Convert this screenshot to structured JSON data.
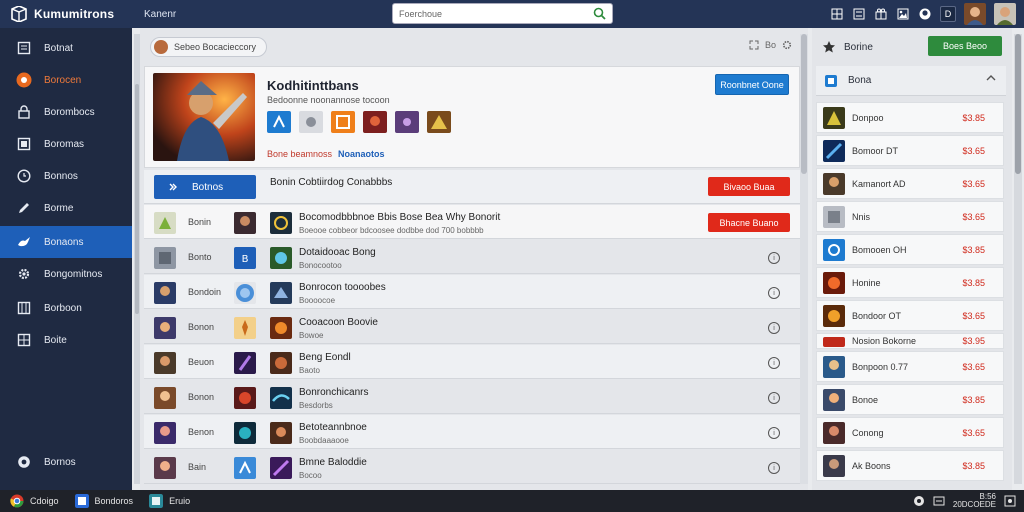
{
  "topbar": {
    "brand": "Kumumitrons",
    "link": "Kanenr",
    "search_placeholder": "Foerchoue",
    "icons": [
      "grid-icon",
      "list-icon",
      "gift-icon",
      "image-icon",
      "github-icon",
      "user-icon"
    ]
  },
  "sidebar": {
    "items": [
      {
        "label": "Botnat",
        "icon": "page-icon"
      },
      {
        "label": "Borocen",
        "icon": "orange-circle-icon"
      },
      {
        "label": "Borombocs",
        "icon": "lock-icon"
      },
      {
        "label": "Boromas",
        "icon": "monitor-icon"
      },
      {
        "label": "Bonnos",
        "icon": "clock-icon"
      },
      {
        "label": "Borme",
        "icon": "pen-icon"
      },
      {
        "label": "Bonaons",
        "icon": "bird-icon"
      },
      {
        "label": "Bongomitnos",
        "icon": "gear-icon"
      },
      {
        "label": "Borboon",
        "icon": "grid-icon"
      },
      {
        "label": "Boite",
        "icon": "table-icon"
      }
    ],
    "footer": {
      "label": "Bornos",
      "icon": "settings-icon"
    }
  },
  "main": {
    "head_pill": "Sebeo Bocacieccory",
    "head_right": "Bo",
    "hero": {
      "title": "Kodhitinttbans",
      "subtitle": "Bedoonne noonannose tocoon",
      "meta_a": "Bone beamnoss",
      "meta_b": "Noanaotos",
      "button": "Roonbnet Oone"
    },
    "rows": [
      {
        "kind": "bar",
        "bar_label": "Botnos",
        "title": "Bonin Cobtiirdog Conabbbs",
        "sub": "",
        "button": "Bivaoo Buaa"
      },
      {
        "kind": "button",
        "name": "Bonin",
        "title": "Bocomodbbbnoe Bbis Bose Bea Why Bonorit",
        "sub": "Boeooe cobbeor bdcoosee dodbbe dod 700 bobbbb",
        "button": "Bhacne Buano"
      },
      {
        "kind": "info",
        "name": "Bonto",
        "title": "Dotaidooac Bong",
        "sub": "Bonocootoo"
      },
      {
        "kind": "info",
        "name": "Bondoin",
        "title": "Bonrocon toooobes",
        "sub": "Boooocoe"
      },
      {
        "kind": "info",
        "name": "Bonon",
        "title": "Cooacoon Boovie",
        "sub": "Bowoe"
      },
      {
        "kind": "info",
        "name": "Beuon",
        "title": "Beng Eondl",
        "sub": "Baoto"
      },
      {
        "kind": "info",
        "name": "Bonon",
        "title": "Bonronchicanrs",
        "sub": "Besdorbs"
      },
      {
        "kind": "info",
        "name": "Benon",
        "title": "Betoteannbnoe",
        "sub": "Boobdaaaooe"
      },
      {
        "kind": "info",
        "name": "Bain",
        "title": "Bmne Baloddie",
        "sub": "Bocoo"
      }
    ]
  },
  "right": {
    "head": "Borine",
    "green_button": "Boes Beoo",
    "sub": "Bona",
    "items": [
      {
        "name": "Donpoo",
        "price": "$3.85"
      },
      {
        "name": "Bomoor DT",
        "price": "$3.65"
      },
      {
        "name": "Kamanort AD",
        "price": "$3.65"
      },
      {
        "name": "Nnis",
        "price": "$3.65"
      },
      {
        "name": "Bomooen OH",
        "price": "$3.85"
      },
      {
        "name": "Honine",
        "price": "$3.85"
      },
      {
        "name": "Bondoor OT",
        "price": "$3.65"
      },
      {
        "name": "Nosion Bokorne",
        "price": "$3.95"
      },
      {
        "name": "Bonpoon 0.77",
        "price": "$3.65"
      },
      {
        "name": "Bonoe",
        "price": "$3.85"
      },
      {
        "name": "Conong",
        "price": "$3.65"
      },
      {
        "name": "Ak Boons",
        "price": "$3.85"
      }
    ]
  },
  "taskbar": {
    "items": [
      "Cdoigo",
      "Bondoros",
      "Eruio"
    ],
    "clock_top": "B:56",
    "clock_bottom": "20DCOEDE"
  },
  "colors": {
    "topbar": "#243456",
    "sidebar": "#1f2a42",
    "active": "#1e5fb8",
    "primary_button": "#1e7bd0",
    "red_button": "#e0291a",
    "green_button": "#2e8b3d",
    "price": "#d0281b"
  }
}
